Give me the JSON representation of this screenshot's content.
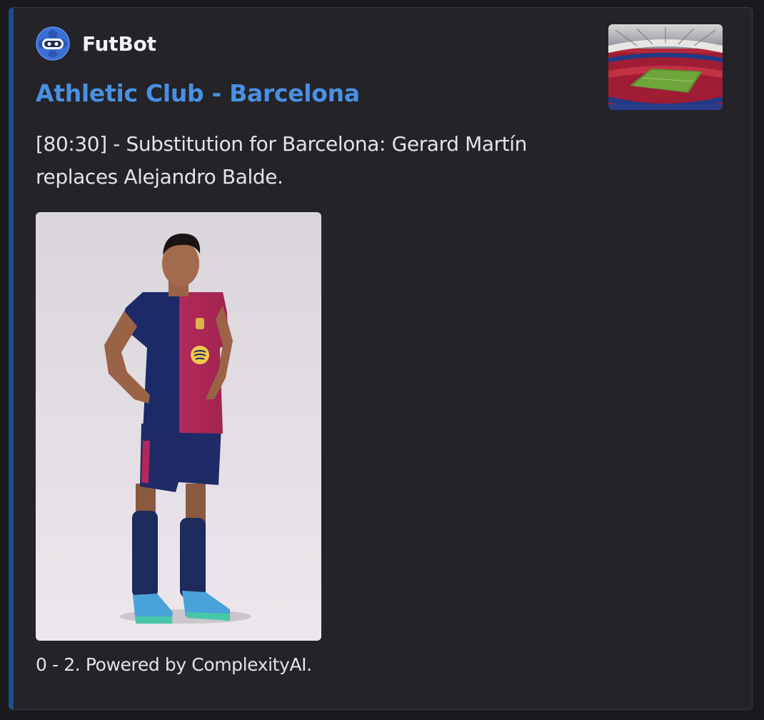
{
  "author": {
    "name": "FutBot",
    "avatar_icon": "robot-ball-icon"
  },
  "embed": {
    "title": "Athletic Club - Barcelona",
    "description": "[80:30] - Substitution for Barcelona: Gerard Martín replaces Alejandro Balde.",
    "footer": "0 - 2. Powered by ComplexityAI.",
    "accent_color": "#1e4e8c",
    "title_color": "#4a90e2"
  },
  "thumbnail": {
    "icon": "stadium-image"
  },
  "image": {
    "icon": "player-photo-image"
  }
}
